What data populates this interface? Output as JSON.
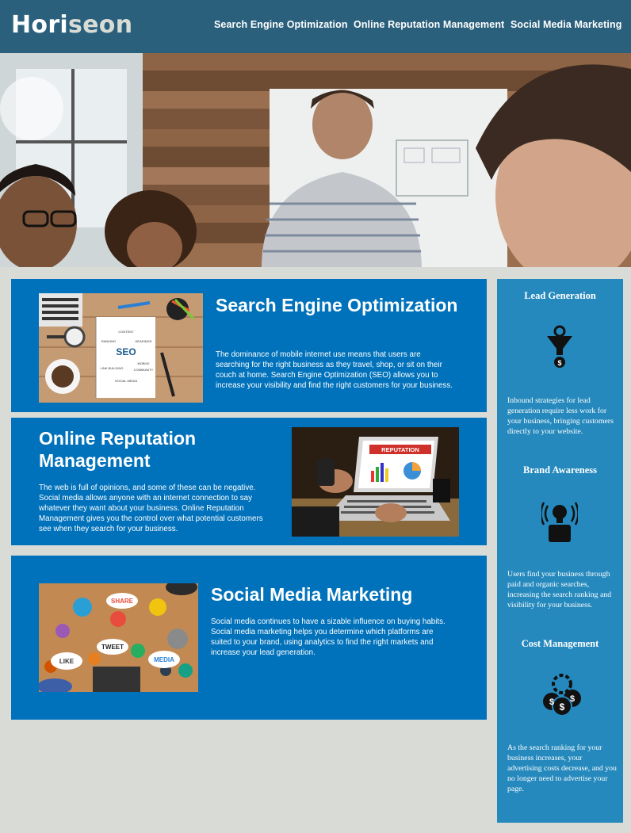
{
  "header": {
    "logo_main": "Hori",
    "logo_accent": "seon",
    "nav": [
      {
        "label": "Search Engine Optimization"
      },
      {
        "label": "Online Reputation Management"
      },
      {
        "label": "Social Media Marketing"
      }
    ]
  },
  "content": [
    {
      "title": "Search Engine Optimization",
      "text": "The dominance of mobile internet use means that users are searching for the right business as they travel, shop, or sit on their couch at home. Search Engine Optimization (SEO) allows you to increase your visibility and find the right customers for your business.",
      "image_words": {
        "seo": "SEO",
        "content": "CONTENT",
        "headings": "HEADINGS",
        "ranking": "RANKING",
        "link_building": "LINK BUILDING",
        "social_media": "SOCIAL MEDIA",
        "mobile": "MOBILE",
        "community": "COMMUNITY"
      }
    },
    {
      "title": "Online Reputation Management",
      "text": "The web is full of opinions, and some of these can be negative. Social media allows anyone with an internet connection to say whatever they want about your business. Online Reputation Management gives you the control over what potential customers see when they search for your business.",
      "image_word": "REPUTATION"
    },
    {
      "title": "Social Media Marketing",
      "text": "Social media continues to have a sizable influence on buying habits. Social media marketing helps you determine which platforms are suited to your brand, using analytics to find the right markets and increase your lead generation.",
      "image_words": {
        "share": "SHARE",
        "tweet": "TWEET",
        "like": "LIKE",
        "media": "MEDIA"
      }
    }
  ],
  "benefits": [
    {
      "title": "Lead Generation",
      "icon": "lead-funnel-icon",
      "text": "Inbound strategies for lead generation require less work for your business, bringing customers directly to your website."
    },
    {
      "title": "Brand Awareness",
      "icon": "brand-bulb-icon",
      "text": "Users find your business through paid and organic searches, increasing the search ranking and visibility for your business."
    },
    {
      "title": "Cost Management",
      "icon": "cost-coins-icon",
      "text": "As the search ranking for your business increases, your advertising costs decrease, and you no longer need to advertise your page."
    }
  ],
  "colors": {
    "header": "#2a607c",
    "card": "#0072bb",
    "sidebar": "#2589bd",
    "background": "#d9dcd6"
  }
}
